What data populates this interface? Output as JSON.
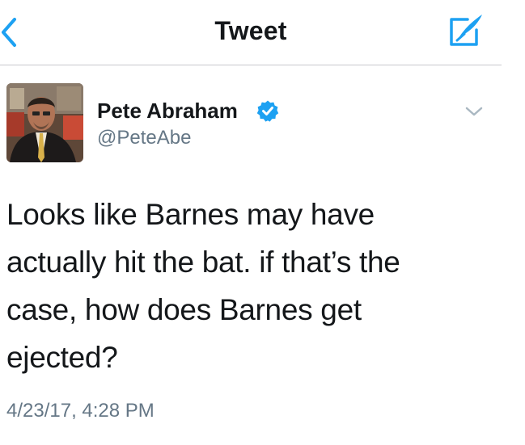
{
  "nav": {
    "title": "Tweet",
    "back_icon": "chevron-left-icon",
    "compose_icon": "compose-tweet-icon"
  },
  "tweet": {
    "author_name": "Pete Abraham",
    "author_handle": "@PeteAbe",
    "verified": true,
    "text": "Looks like Barnes may have actually hit the bat. if that’s the case, how does Barnes get ejected?",
    "timestamp": "4/23/17, 4:28 PM"
  },
  "colors": {
    "accent": "#1da1f2",
    "text": "#14171a",
    "secondary_text": "#657786",
    "divider": "#c8c8cc"
  }
}
